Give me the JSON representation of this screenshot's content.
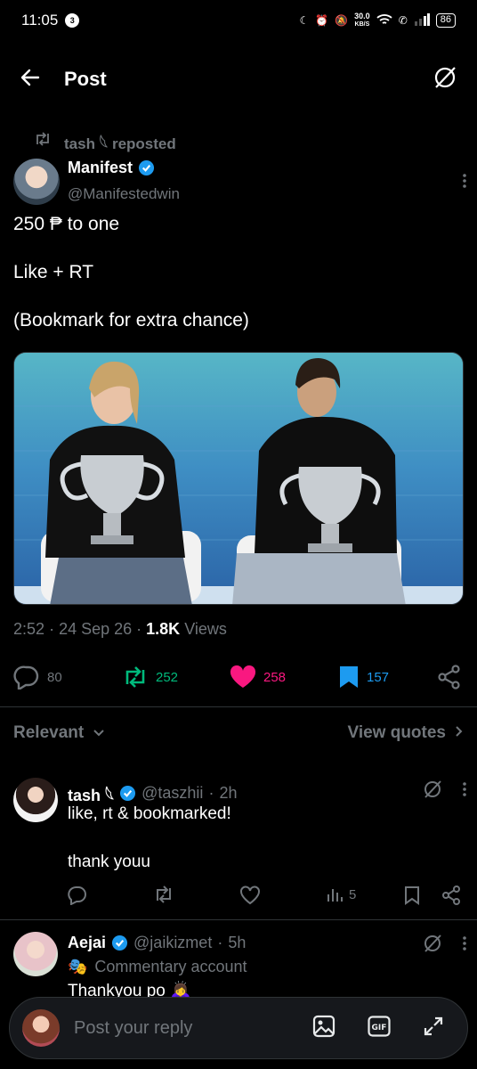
{
  "status": {
    "time": "11:05",
    "notif_count": "3",
    "speed": "30.0",
    "speed_unit": "KB/S",
    "battery": "86"
  },
  "header": {
    "title": "Post"
  },
  "repost": {
    "text": "tash 𓆩 reposted"
  },
  "post": {
    "author_name": "Manifest",
    "author_handle": "@Manifestedwin",
    "lines": [
      "250 ₱ to one",
      "Like + RT",
      "(Bookmark for extra chance)"
    ],
    "time": "2:52",
    "date": "24 Sep 26",
    "views_count": "1.8K",
    "views_label": "Views",
    "replies": "80",
    "reposts": "252",
    "likes": "258",
    "bookmarks": "157"
  },
  "tabs": {
    "relevant": "Relevant",
    "view_quotes": "View quotes"
  },
  "replies": [
    {
      "name": "tash 𓆩",
      "handle": "@taszhii",
      "time": "2h",
      "text1": "like, rt & bookmarked!",
      "text2": "thank youu",
      "views": "5"
    },
    {
      "name": "Aejai",
      "handle": "@jaikizmet",
      "time": "5h",
      "label": "Commentary account",
      "text1": "Thankyou po 🙇‍♀️"
    }
  ],
  "composer": {
    "placeholder": "Post your reply"
  },
  "colors": {
    "accent": "#1d9bf0",
    "repost": "#00ba7c",
    "like": "#f91880",
    "muted": "#71767b"
  }
}
